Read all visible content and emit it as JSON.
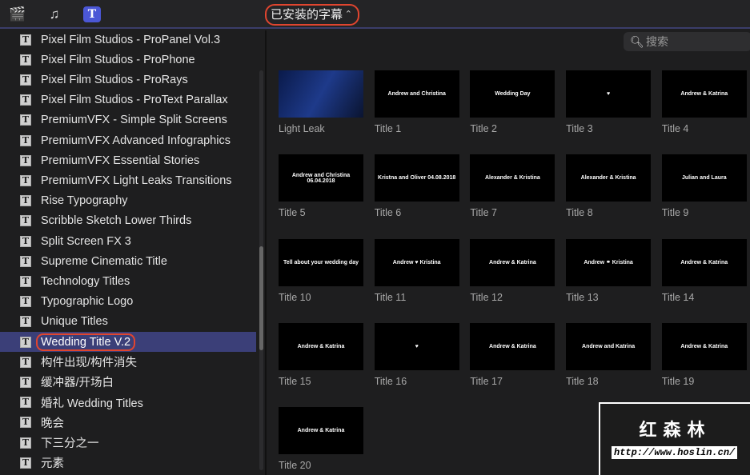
{
  "toolbar": {
    "icons": [
      "clapper-star-icon",
      "music-photo-icon",
      "titles-icon"
    ],
    "selector_label": "已安装的字幕",
    "selector_chevron": "⌃⌄"
  },
  "search": {
    "placeholder": "搜索",
    "icon": "⌕"
  },
  "sidebar": {
    "items": [
      "Pixel Film Studios - ProPanel Vol.3",
      "Pixel Film Studios - ProPhone",
      "Pixel Film Studios - ProRays",
      "Pixel Film Studios - ProText Parallax",
      "PremiumVFX - Simple Split Screens",
      "PremiumVFX Advanced Infographics",
      "PremiumVFX Essential Stories",
      "PremiumVFX Light Leaks Transitions",
      "Rise Typography",
      "Scribble Sketch Lower Thirds",
      "Split Screen FX 3",
      "Supreme Cinematic Title",
      "Technology Titles",
      "Typographic Logo",
      "Unique Titles",
      "Wedding Title V.2",
      "构件出现/构件消失",
      "缓冲器/开场白",
      "婚礼 Wedding Titles",
      "晚会",
      "下三分之一",
      "元素"
    ],
    "selected_index": 15,
    "icon_glyph": "T"
  },
  "grid": [
    {
      "label": "Light Leak",
      "thumb": ""
    },
    {
      "label": "Title 1",
      "thumb": "Andrew and Christina"
    },
    {
      "label": "Title 2",
      "thumb": "Wedding Day"
    },
    {
      "label": "Title 3",
      "thumb": "♥"
    },
    {
      "label": "Title 4",
      "thumb": "Andrew & Katrina"
    },
    {
      "label": "Title 5",
      "thumb": "Andrew and Christina 06.04.2018"
    },
    {
      "label": "Title 6",
      "thumb": "Kristna and Oliver 04.08.2018"
    },
    {
      "label": "Title 7",
      "thumb": "Alexander & Kristina"
    },
    {
      "label": "Title 8",
      "thumb": "Alexander & Kristina"
    },
    {
      "label": "Title 9",
      "thumb": "Julian and Laura"
    },
    {
      "label": "Title 10",
      "thumb": "Tell about your wedding day"
    },
    {
      "label": "Title 11",
      "thumb": "Andrew ♥ Kristina"
    },
    {
      "label": "Title 12",
      "thumb": "Andrew & Katrina"
    },
    {
      "label": "Title 13",
      "thumb": "Andrew ⚭ Kristina"
    },
    {
      "label": "Title 14",
      "thumb": "Andrew & Katrina"
    },
    {
      "label": "Title 15",
      "thumb": "Andrew & Katrina"
    },
    {
      "label": "Title 16",
      "thumb": "♥"
    },
    {
      "label": "Title 17",
      "thumb": "Andrew & Katrina"
    },
    {
      "label": "Title 18",
      "thumb": "Andrew and Katrina"
    },
    {
      "label": "Title 19",
      "thumb": "Andrew & Katrina"
    },
    {
      "label": "Title 20",
      "thumb": "Andrew & Katrina"
    }
  ],
  "watermark": {
    "name": "红森林",
    "url": "http://www.hoslin.cn/"
  }
}
